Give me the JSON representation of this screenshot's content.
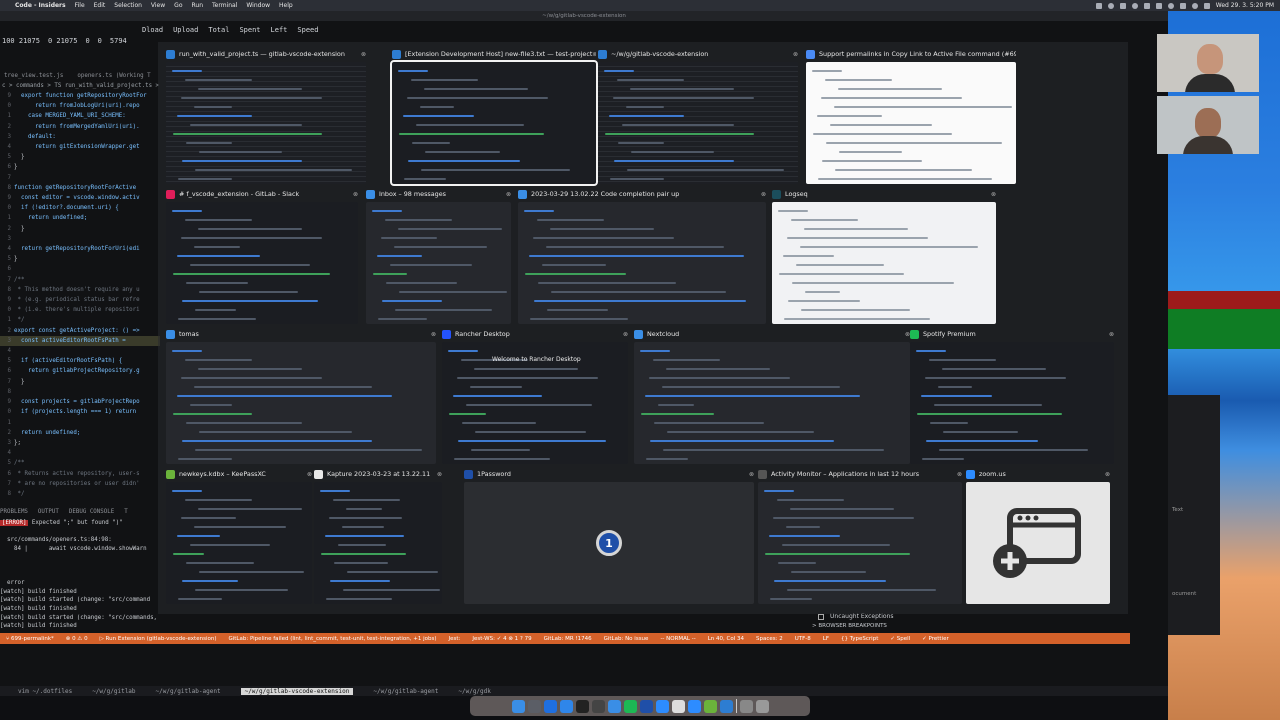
{
  "menubar": {
    "apple": "",
    "app_name": "Code - Insiders",
    "menus": [
      "File",
      "Edit",
      "Selection",
      "View",
      "Go",
      "Run",
      "Terminal",
      "Window",
      "Help"
    ],
    "clock": "Wed 29. 3.  5:20 PM"
  },
  "window_title": "~/w/g/gitlab-vscode-extension",
  "top_stats": {
    "headers": [
      "Dload",
      "Upload",
      "Total",
      "Spent",
      "Left",
      "Speed"
    ],
    "row": [
      "100 21075",
      "0 21075",
      "0",
      "0",
      "5794"
    ]
  },
  "editor": {
    "tabs": [
      "tree_view.test.js",
      "openers.ts (Working T"
    ],
    "breadcrumb": "c > commands > TS run_with_valid_project.ts >",
    "lines": [
      {
        "n": "9",
        "t": "  export function getRepositoryRootFor"
      },
      {
        "n": "0",
        "t": "      return fromJobLogUri(uri).repo"
      },
      {
        "n": "1",
        "t": "    case MERGED_YAML_URI_SCHEME:"
      },
      {
        "n": "2",
        "t": "      return fromMergedYamlUri(uri)."
      },
      {
        "n": "3",
        "t": "    default:"
      },
      {
        "n": "4",
        "t": "      return gitExtensionWrapper.get"
      },
      {
        "n": "5",
        "t": "  }"
      },
      {
        "n": "6",
        "t": "}"
      },
      {
        "n": "7",
        "t": ""
      },
      {
        "n": "8",
        "t": "function getRepositoryRootForActive"
      },
      {
        "n": "9",
        "t": "  const editor = vscode.window.activ"
      },
      {
        "n": "0",
        "t": "  if (!editor?.document.uri) {"
      },
      {
        "n": "1",
        "t": "    return undefined;"
      },
      {
        "n": "2",
        "t": "  }"
      },
      {
        "n": "3",
        "t": ""
      },
      {
        "n": "4",
        "t": "  return getRepositoryRootForUri(edi"
      },
      {
        "n": "5",
        "t": "}"
      },
      {
        "n": "6",
        "t": ""
      },
      {
        "n": "7",
        "t": "/**"
      },
      {
        "n": "8",
        "t": " * This method doesn't require any u"
      },
      {
        "n": "9",
        "t": " * (e.g. periodical status bar refre"
      },
      {
        "n": "0",
        "t": " * (i.e. there's multiple repositori"
      },
      {
        "n": "1",
        "t": " */"
      },
      {
        "n": "2",
        "t": "export const getActiveProject: () =>"
      },
      {
        "n": "3",
        "t": "  const activeEditorRootFsPath = ",
        "hl": true
      },
      {
        "n": "4",
        "t": ""
      },
      {
        "n": "5",
        "t": "  if (activeEditorRootFsPath) {"
      },
      {
        "n": "6",
        "t": "    return gitlabProjectRepository.g"
      },
      {
        "n": "7",
        "t": "  }"
      },
      {
        "n": "8",
        "t": ""
      },
      {
        "n": "9",
        "t": "  const projects = gitlabProjectRepo"
      },
      {
        "n": "0",
        "t": "  if (projects.length === 1) return"
      },
      {
        "n": "1",
        "t": ""
      },
      {
        "n": "2",
        "t": "  return undefined;"
      },
      {
        "n": "3",
        "t": "};"
      },
      {
        "n": "4",
        "t": ""
      },
      {
        "n": "5",
        "t": "/**"
      },
      {
        "n": "6",
        "t": " * Returns active repository, user-s"
      },
      {
        "n": "7",
        "t": " * are no repositories or user didn'"
      },
      {
        "n": "8",
        "t": " */"
      },
      {
        "n": "9",
        "t": "export const getActiveProjectOrSelec"
      },
      {
        "n": "0",
        "t": "  ProjectInRepository | undefined"
      },
      {
        "n": "1",
        "t": "> = async () => {"
      },
      {
        "n": "2",
        "t": "  const activeProject = getActivePro"
      }
    ]
  },
  "panel": {
    "tabs": [
      "PROBLEMS",
      "OUTPUT",
      "DEBUG CONSOLE",
      "T"
    ],
    "error_tag": "[ERROR]",
    "error_text": " Expected \";\" but found \")\"",
    "lines": [
      "",
      "  src/commands/openers.ts:84:98:",
      "    84 |      await vscode.window.showWarn",
      "",
      "",
      "",
      "  error",
      "[watch] build finished",
      "[watch] build started (change: \"src/command",
      "[watch] build finished",
      "[watch] build started (change: \"src/commands,",
      "[watch] build finished"
    ]
  },
  "status_bar": [
    "⑂ 699-permalink*",
    "⊗ 0 ⚠ 0",
    "▷ Run Extension (gitlab-vscode-extension)",
    "GitLab: Pipeline failed (lint, lint_commit, test-unit, test-integration, +1 jobs)",
    "Jest:",
    "Jest-WS: ✓ 4 ⊗ 1 ? 79",
    "GitLab: MR !1746",
    "GitLab: No issue",
    "-- NORMAL --",
    "Ln 40, Col 34",
    "Spaces: 2",
    "UTF-8",
    "LF",
    "{} TypeScript",
    "✓ Spell",
    "✓ Prettier"
  ],
  "debug": {
    "uncaught": "Uncaught Exceptions",
    "breakpoints": "> BROWSER BREAKPOINTS"
  },
  "tmux": {
    "tabs": [
      {
        "label": "vim ~/.dotfiles",
        "active": false
      },
      {
        "label": "~/w/g/gitlab",
        "active": false
      },
      {
        "label": "~/w/g/gitlab-agent",
        "active": false
      },
      {
        "label": "~/w/g/gitlab-vscode-extension",
        "active": true
      },
      {
        "label": "~/w/g/gitlab-agent",
        "active": false
      },
      {
        "label": "~/w/g/gdk",
        "active": false
      }
    ]
  },
  "windows": [
    {
      "title": "run_with_valid_project.ts — gitlab-vscode-extension",
      "icon_color": "#2d7dd2",
      "thumb": "code"
    },
    {
      "title": "[Extension Development Host] new-file3.txt — test-project",
      "icon_color": "#2d7dd2",
      "thumb": "dark",
      "selected": true
    },
    {
      "title": "~/w/g/gitlab-vscode-extension",
      "icon_color": "#2d7dd2",
      "thumb": "code"
    },
    {
      "title": "Support permalinks in Copy Link to Active File command (#69...",
      "icon_color": "#4a8af4",
      "thumb": "docs"
    },
    {
      "title": "# f_vscode_extension - GitLab - Slack",
      "icon_color": "#e01e5a",
      "thumb": "dark"
    },
    {
      "title": "Inbox – 98 messages",
      "icon_color": "#3a8ee6",
      "thumb": "mid"
    },
    {
      "title": "2023-03-29 13.02.22 Code completion pair up",
      "icon_color": "#3a8ee6",
      "thumb": "mid"
    },
    {
      "title": "Logseq",
      "icon_color": "#1b4d5c",
      "thumb": "light"
    },
    {
      "title": "tomas",
      "icon_color": "#3a8ee6",
      "thumb": "mid"
    },
    {
      "title": "Rancher Desktop",
      "icon_color": "#2453ff",
      "thumb": "dark",
      "rancher_heading": "Welcome to Rancher Desktop"
    },
    {
      "title": "Nextcloud",
      "icon_color": "#3a8ee6",
      "thumb": "mid"
    },
    {
      "title": "Spotify Premium",
      "icon_color": "#1db954",
      "thumb": "dark"
    },
    {
      "title": "newkeys.kdbx – KeePassXC",
      "icon_color": "#6bb33b",
      "thumb": "dark"
    },
    {
      "title": "Kapture 2023-03-23 at 13.22.11",
      "icon_color": "#e8e8e8",
      "thumb": "dark"
    },
    {
      "title": "1Password",
      "icon_color": "#1f4fa8",
      "thumb": "onepass",
      "onepass_glyph": "1"
    },
    {
      "title": "Activity Monitor – Applications in last 12 hours",
      "icon_color": "#555",
      "thumb": "mid"
    },
    {
      "title": "zoom.us",
      "icon_color": "#2d8cff",
      "thumb": "zoom"
    }
  ],
  "right_panel": [
    "Text",
    "ocument"
  ]
}
